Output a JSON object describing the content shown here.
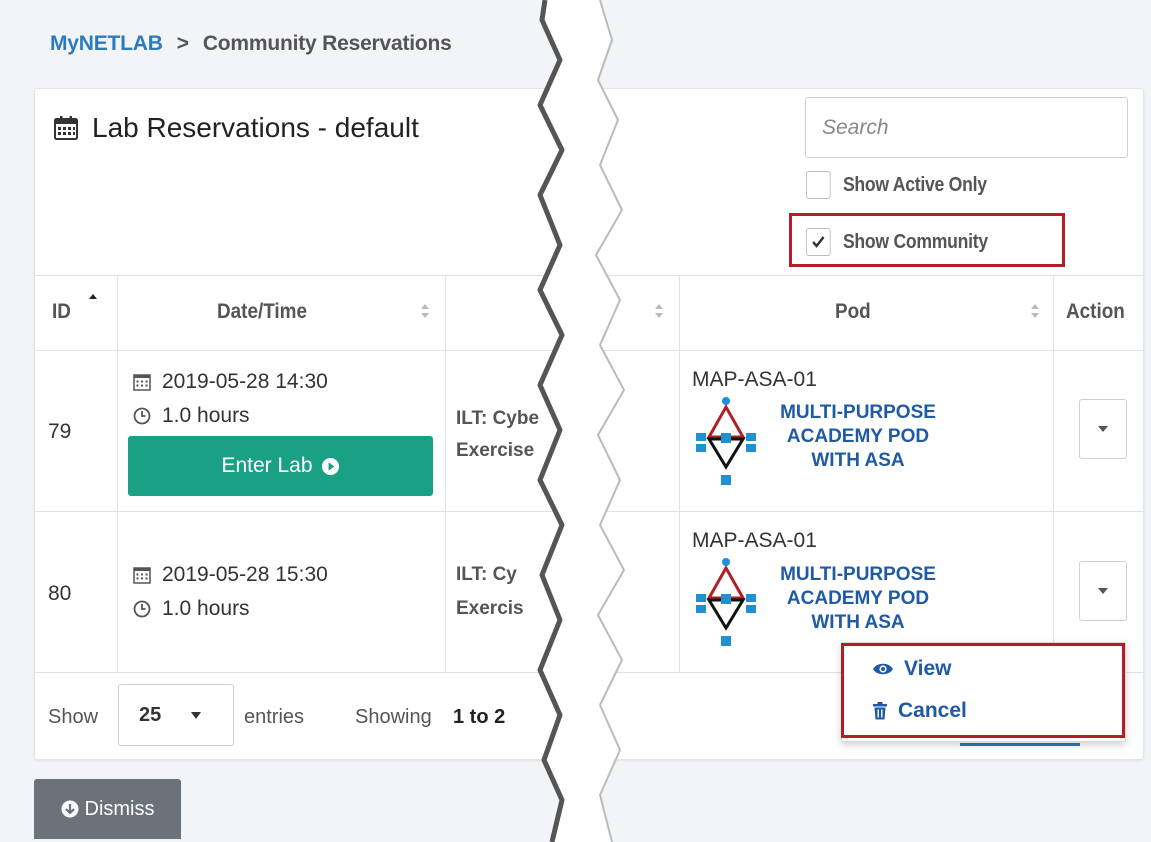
{
  "breadcrumb": {
    "home": "MyNETLAB",
    "separator": ">",
    "current": "Community Reservations"
  },
  "title": "Lab Reservations - default",
  "search": {
    "placeholder": "Search"
  },
  "filters": {
    "active_only": {
      "label": "Show Active Only",
      "checked": false
    },
    "community": {
      "label": "Show Community",
      "checked": true
    }
  },
  "table": {
    "headers": {
      "id": "ID",
      "datetime": "Date/Time",
      "pod": "Pod",
      "action": "Action"
    },
    "rows": [
      {
        "id": "79",
        "date": "2019-05-28 14:30",
        "duration": "1.0 hours",
        "enter_label": "Enter Lab",
        "exercise_line1": "ILT: Cybe",
        "exercise_line2": "Exercise",
        "pod_code": "MAP-ASA-01",
        "pod_name_1": "MULTI-PURPOSE",
        "pod_name_2": "ACADEMY POD",
        "pod_name_3": "WITH ASA"
      },
      {
        "id": "80",
        "date": "2019-05-28 15:30",
        "duration": "1.0 hours",
        "exercise_line1": "ILT: Cy",
        "exercise_line2": "Exercis",
        "pod_code": "MAP-ASA-01",
        "pod_name_1": "MULTI-PURPOSE",
        "pod_name_2": "ACADEMY POD",
        "pod_name_3": "WITH ASA"
      }
    ]
  },
  "action_menu": {
    "view": "View",
    "cancel": "Cancel"
  },
  "footer": {
    "show": "Show",
    "entries_value": "25",
    "entries": "entries",
    "showing": "Showing",
    "range": "1 to 2"
  },
  "dismiss": "Dismiss",
  "colors": {
    "link": "#2c7bbf",
    "pod_blue": "#1f5aa6",
    "green": "#19a085",
    "highlight": "#b01f24",
    "dismiss_gray": "#6b727a"
  }
}
